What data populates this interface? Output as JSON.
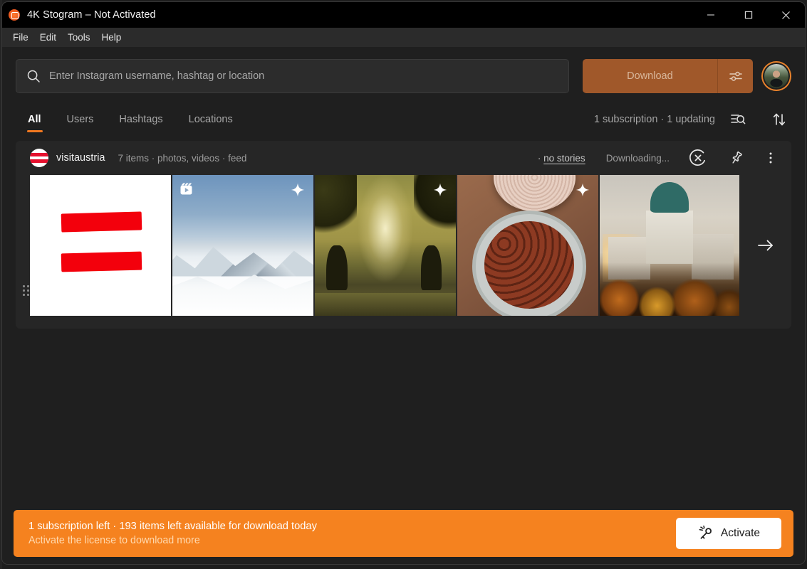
{
  "window": {
    "title": "4K Stogram – Not Activated",
    "app_icon": "stogram-app-icon",
    "controls": {
      "minimize": "minimize-icon",
      "maximize": "maximize-icon",
      "close": "close-icon"
    }
  },
  "menubar": {
    "items": [
      {
        "label": "File"
      },
      {
        "label": "Edit"
      },
      {
        "label": "Tools"
      },
      {
        "label": "Help"
      }
    ]
  },
  "search": {
    "icon": "search-icon",
    "value": "",
    "placeholder": "Enter Instagram username, hashtag or location"
  },
  "toolbar": {
    "download_label": "Download",
    "download_options_icon": "sliders-icon",
    "account_avatar": "user-avatar"
  },
  "tabs": [
    {
      "label": "All",
      "active": true
    },
    {
      "label": "Users",
      "active": false
    },
    {
      "label": "Hashtags",
      "active": false
    },
    {
      "label": "Locations",
      "active": false
    }
  ],
  "status": {
    "subscriptions_text": "1 subscription · 1 updating",
    "filter_icon": "filter-search-icon",
    "sort_icon": "sort-arrows-icon"
  },
  "subscription": {
    "avatar_icon": "austria-flag-avatar",
    "name": "visitaustria",
    "meta": "7 items · photos, videos · feed",
    "stories_prefix": "· ",
    "stories_label": "no stories",
    "download_status": "Downloading...",
    "cancel_icon": "cancel-progress-icon",
    "pin_icon": "pin-icon",
    "more_icon": "more-vertical-icon",
    "drag_handle_icon": "drag-handle-icon",
    "next_arrow_icon": "arrow-right-icon",
    "thumbnails": [
      {
        "name": "austria-flag-thumbnail",
        "art": "flag",
        "reel": false,
        "star": false
      },
      {
        "name": "snowy-mountains-thumbnail",
        "art": "mountains",
        "reel": true,
        "star": true
      },
      {
        "name": "fountain-park-thumbnail",
        "art": "fountain",
        "reel": false,
        "star": true
      },
      {
        "name": "roasted-chestnuts-thumbnail",
        "art": "nuts",
        "reel": false,
        "star": true
      },
      {
        "name": "karlskirche-autumn-thumbnail",
        "art": "church",
        "reel": false,
        "star": false
      }
    ]
  },
  "banner": {
    "line1": "1 subscription left · 193 items left available for download today",
    "line2": "Activate the license to download more",
    "activate_label": "Activate",
    "activate_icon": "key-icon"
  },
  "colors": {
    "accent": "#f07820",
    "banner_bg": "#f5821f",
    "download_btn": "#a0582a",
    "window_bg": "#1f1f1f",
    "card_bg": "#262626",
    "titlebar_bg": "#000000"
  }
}
